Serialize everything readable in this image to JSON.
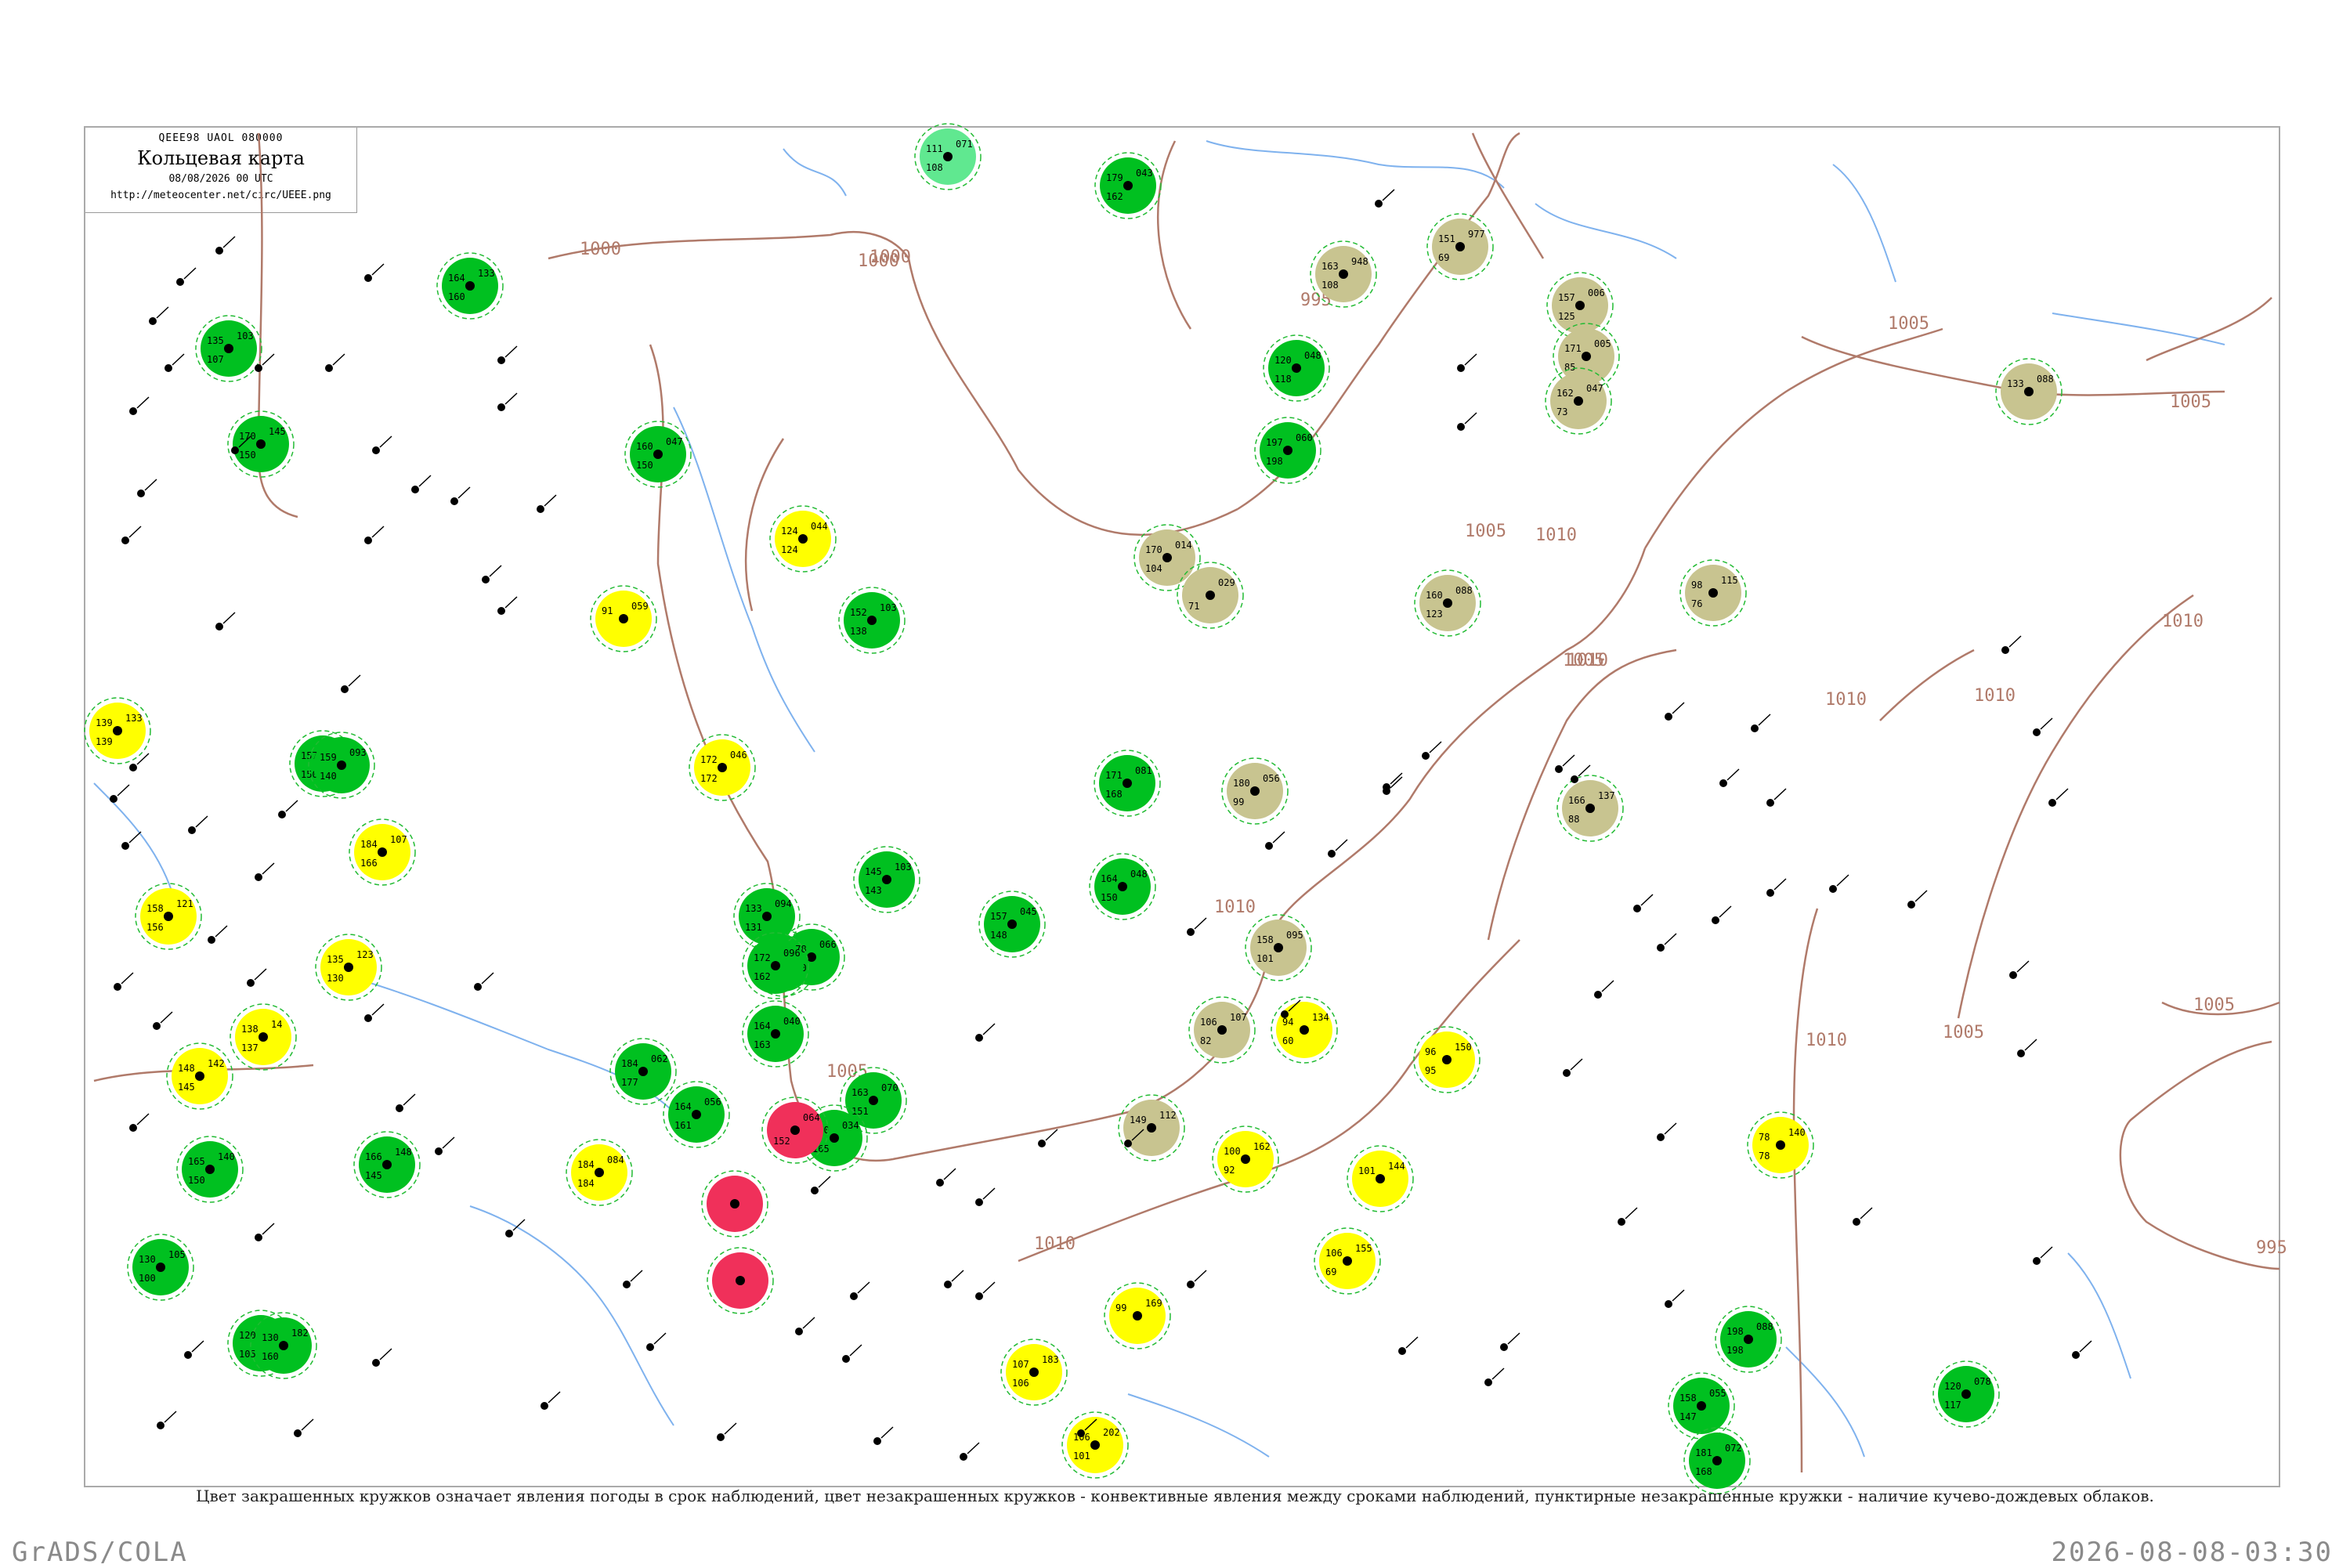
{
  "legend": {
    "code": "QEEE98  UAOL  080000",
    "title": "Кольцевая карта",
    "datetime": "08/08/2026 00 UTC",
    "url": "http://meteocenter.net/circ/UEEE.png"
  },
  "caption": "Цвет закрашенных кружков означает явления погоды в срок наблюдений, цвет незакрашенных кружков - конвективные явления между сроками наблюдений, пунктирные незакрашенные кружки - наличие кучево-дождевых облаков.",
  "footer": {
    "left": "GrADS/COLA",
    "right": "2026-08-08-03:30"
  },
  "isobars": [
    {
      "label": "1000"
    },
    {
      "label": "1000"
    },
    {
      "label": "1000"
    },
    {
      "label": "995"
    },
    {
      "label": "1005"
    },
    {
      "label": "1005"
    },
    {
      "label": "1005"
    },
    {
      "label": "1005"
    },
    {
      "label": "1010"
    },
    {
      "label": "1010"
    },
    {
      "label": "1010"
    },
    {
      "label": "1010"
    },
    {
      "label": "1005"
    },
    {
      "label": "1010"
    },
    {
      "label": "1005"
    },
    {
      "label": "995"
    },
    {
      "label": "1010"
    },
    {
      "label": "1005"
    },
    {
      "label": "1010"
    },
    {
      "label": "1010"
    }
  ],
  "colors": {
    "thunder": "#00c020",
    "rain": "#ffff00",
    "haze": "#c8c490",
    "hail": "#f0305a",
    "shower": "#60e890",
    "isobar": "#b07a6a",
    "river": "#7fb2ee",
    "ring": "#22bb33"
  },
  "stations": [
    {
      "name": "thunder",
      "p": "105",
      "t": "130",
      "d": "100"
    },
    {
      "name": "thunder",
      "p": "103",
      "t": "135",
      "d": "107"
    },
    {
      "name": "thunder",
      "p": "145",
      "t": "170",
      "d": "150"
    },
    {
      "name": "thunder",
      "p": "140",
      "t": "165",
      "d": "150"
    },
    {
      "name": "thunder",
      "p": "148",
      "t": "166",
      "d": "145"
    },
    {
      "name": "thunder",
      "p": "110",
      "t": "120",
      "d": "105"
    },
    {
      "name": "thunder",
      "p": "182",
      "t": "130",
      "d": "160"
    },
    {
      "name": "thunder",
      "p": "084",
      "t": "157",
      "d": "150"
    },
    {
      "name": "thunder",
      "p": "093",
      "t": "159",
      "d": "140"
    },
    {
      "name": "thunder",
      "p": "133",
      "t": "164",
      "d": "160"
    },
    {
      "name": "thunder",
      "p": "047",
      "t": "160",
      "d": "150"
    },
    {
      "name": "thunder",
      "p": "103",
      "t": "152",
      "d": "138"
    },
    {
      "name": "thunder",
      "p": "062",
      "t": "184",
      "d": "177"
    },
    {
      "name": "thunder",
      "p": "056",
      "t": "164",
      "d": "161"
    },
    {
      "name": "thunder",
      "p": "103",
      "t": "145",
      "d": "143"
    },
    {
      "name": "thunder",
      "p": "070",
      "t": "163",
      "d": "151"
    },
    {
      "name": "thunder",
      "p": "034",
      "t": "170",
      "d": "165"
    },
    {
      "name": "thunder",
      "p": "040",
      "t": "164",
      "d": "163"
    },
    {
      "name": "thunder",
      "p": "054",
      "t": "160",
      "d": "160"
    },
    {
      "name": "thunder",
      "p": "066",
      "t": "178",
      "d": "170"
    },
    {
      "name": "thunder",
      "p": "094",
      "t": "133",
      "d": "131"
    },
    {
      "name": "thunder",
      "p": "096",
      "t": "172",
      "d": "162"
    },
    {
      "name": "thunder",
      "p": "045",
      "t": "157",
      "d": "148"
    },
    {
      "name": "thunder",
      "p": "048",
      "t": "164",
      "d": "150"
    },
    {
      "name": "thunder",
      "p": "081",
      "t": "171",
      "d": "168"
    },
    {
      "name": "thunder",
      "p": "043",
      "t": "179",
      "d": "162"
    },
    {
      "name": "thunder",
      "p": "048",
      "t": "120",
      "d": "118"
    },
    {
      "name": "thunder",
      "p": "060",
      "t": "197",
      "d": "198"
    },
    {
      "name": "thunder",
      "p": "055",
      "t": "158",
      "d": "147"
    },
    {
      "name": "thunder",
      "p": "072",
      "t": "181",
      "d": "168"
    },
    {
      "name": "thunder",
      "p": "078",
      "t": "120",
      "d": "117"
    },
    {
      "name": "thunder",
      "p": "088",
      "t": "198",
      "d": "198"
    },
    {
      "name": "rain",
      "p": "059",
      "t": "91",
      "d": ""
    },
    {
      "name": "rain",
      "p": "044",
      "t": "124",
      "d": "124"
    },
    {
      "name": "rain",
      "p": "046",
      "t": "172",
      "d": "172"
    },
    {
      "name": "rain",
      "p": "133",
      "t": "139",
      "d": "139"
    },
    {
      "name": "rain",
      "p": "121",
      "t": "158",
      "d": "156"
    },
    {
      "name": "rain",
      "p": "142",
      "t": "148",
      "d": "145"
    },
    {
      "name": "rain",
      "p": "14",
      "t": "138",
      "d": "137"
    },
    {
      "name": "rain",
      "p": "123",
      "t": "135",
      "d": "130"
    },
    {
      "name": "rain",
      "p": "107",
      "t": "184",
      "d": "166"
    },
    {
      "name": "rain",
      "p": "084",
      "t": "184",
      "d": "184"
    },
    {
      "name": "rain",
      "p": "134",
      "t": "94",
      "d": "60"
    },
    {
      "name": "rain",
      "p": "162",
      "t": "100",
      "d": "92"
    },
    {
      "name": "rain",
      "p": "144",
      "t": "101",
      "d": ""
    },
    {
      "name": "rain",
      "p": "155",
      "t": "106",
      "d": "69"
    },
    {
      "name": "rain",
      "p": "169",
      "t": "99",
      "d": ""
    },
    {
      "name": "rain",
      "p": "183",
      "t": "107",
      "d": "106"
    },
    {
      "name": "rain",
      "p": "202",
      "t": "106",
      "d": "101"
    },
    {
      "name": "rain",
      "p": "150",
      "t": "96",
      "d": "95"
    },
    {
      "name": "rain",
      "p": "140",
      "t": "78",
      "d": "78"
    },
    {
      "name": "haze",
      "p": "948",
      "t": "163",
      "d": "108"
    },
    {
      "name": "haze",
      "p": "977",
      "t": "151",
      "d": "69"
    },
    {
      "name": "haze",
      "p": "006",
      "t": "157",
      "d": "125"
    },
    {
      "name": "haze",
      "p": "005",
      "t": "171",
      "d": "85"
    },
    {
      "name": "haze",
      "p": "047",
      "t": "162",
      "d": "73"
    },
    {
      "name": "haze",
      "p": "088",
      "t": "133",
      "d": ""
    },
    {
      "name": "haze",
      "p": "014",
      "t": "170",
      "d": "104"
    },
    {
      "name": "haze",
      "p": "029",
      "t": "",
      "d": "71"
    },
    {
      "name": "haze",
      "p": "088",
      "t": "160",
      "d": "123"
    },
    {
      "name": "haze",
      "p": "115",
      "t": "98",
      "d": "76"
    },
    {
      "name": "haze",
      "p": "056",
      "t": "180",
      "d": "99"
    },
    {
      "name": "haze",
      "p": "137",
      "t": "166",
      "d": "88"
    },
    {
      "name": "haze",
      "p": "095",
      "t": "158",
      "d": "101"
    },
    {
      "name": "haze",
      "p": "107",
      "t": "106",
      "d": "82"
    },
    {
      "name": "haze",
      "p": "112",
      "t": "149",
      "d": ""
    },
    {
      "name": "hail",
      "p": "064",
      "t": "",
      "d": "152"
    },
    {
      "name": "hail",
      "p": "",
      "t": "",
      "d": ""
    },
    {
      "name": "hail",
      "p": "",
      "t": "",
      "d": ""
    },
    {
      "name": "shower",
      "p": "071",
      "t": "111",
      "d": "108"
    }
  ]
}
